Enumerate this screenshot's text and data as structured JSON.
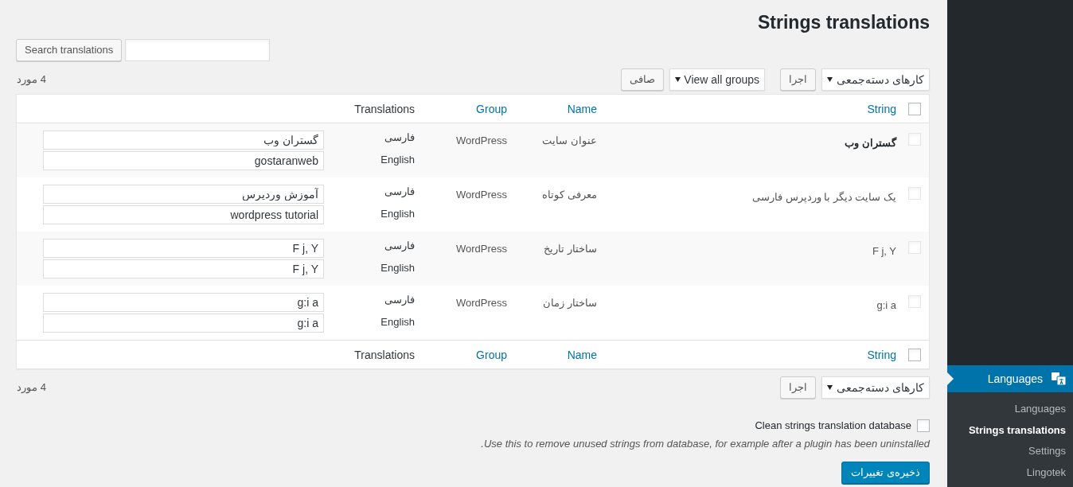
{
  "sidebar": {
    "menu": {
      "label": "Languages",
      "selected": true
    },
    "submenu": [
      {
        "label": "Languages",
        "selected": false
      },
      {
        "label": "Strings translations",
        "selected": true
      },
      {
        "label": "Settings",
        "selected": false
      },
      {
        "label": "Lingotek",
        "selected": false
      }
    ]
  },
  "page_title": "Strings translations",
  "search": {
    "button": "Search translations"
  },
  "top_toolbar": {
    "bulk_action": "کارهای دسته‌جمعی",
    "apply": "اجرا",
    "group_filter": "View all groups",
    "filter": "صافی",
    "item_count": "4 مورد"
  },
  "table": {
    "select_all_checked": false,
    "columns": [
      {
        "label": "String",
        "sortable": true
      },
      {
        "label": "Name",
        "sortable": true
      },
      {
        "label": "Group",
        "sortable": true
      },
      {
        "label": "Translations",
        "sortable": false
      }
    ],
    "rows": [
      {
        "checked": false,
        "string": "گستران وب",
        "emphasized": true,
        "name": "عنوان سایت",
        "group": "WordPress",
        "translations": [
          {
            "language": "فارسی",
            "value": "گستران وب"
          },
          {
            "language": "English",
            "value": "gostaranweb"
          }
        ]
      },
      {
        "checked": false,
        "string": "یک سایت دیگر با وردپرس فارسی",
        "emphasized": false,
        "name": "معرفی کوتاه",
        "group": "WordPress",
        "translations": [
          {
            "language": "فارسی",
            "value": "آموزش وردپرس"
          },
          {
            "language": "English",
            "value": "wordpress tutorial"
          }
        ]
      },
      {
        "checked": false,
        "string": "F j, Y",
        "emphasized": false,
        "name": "ساختار تاریخ",
        "group": "WordPress",
        "translations": [
          {
            "language": "فارسی",
            "value": "F j, Y"
          },
          {
            "language": "English",
            "value": "F j, Y"
          }
        ]
      },
      {
        "checked": false,
        "string": "g:i a",
        "emphasized": false,
        "name": "ساختار زمان",
        "group": "WordPress",
        "translations": [
          {
            "language": "فارسی",
            "value": "g:i a"
          },
          {
            "language": "English",
            "value": "g:i a"
          }
        ]
      }
    ],
    "footer_select_all_checked": false,
    "footer_columns": [
      {
        "label": "String",
        "sortable": true
      },
      {
        "label": "Name",
        "sortable": true
      },
      {
        "label": "Group",
        "sortable": true
      },
      {
        "label": "Translations",
        "sortable": false
      }
    ]
  },
  "bottom_toolbar": {
    "bulk_action": "کارهای دسته‌جمعی",
    "apply": "اجرا",
    "item_count": "4 مورد"
  },
  "clean_option": {
    "label": "Clean strings translation database",
    "checked": false,
    "description": "Use this to remove unused strings from database, for example after a plugin has been uninstalled."
  },
  "save_button": "ذخیره‌ی تغییرات"
}
